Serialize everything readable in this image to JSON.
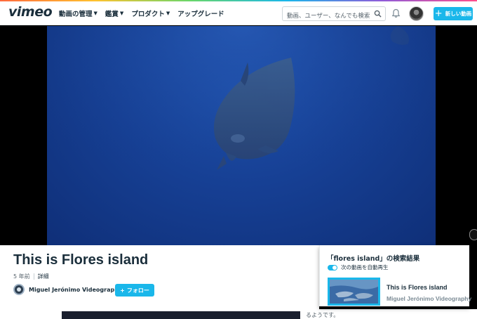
{
  "header": {
    "logo": "vimeo",
    "nav": [
      {
        "label": "動画の管理"
      },
      {
        "label": "鑑賞"
      },
      {
        "label": "プロダクト"
      },
      {
        "label": "アップグレード"
      }
    ],
    "search": {
      "placeholder": "動画、ユーザー、なんでも検索",
      "value": ""
    },
    "new_video_label": "新しい動画"
  },
  "video": {
    "title": "This is Flores island",
    "age": "5 年前",
    "detail_link": "詳細",
    "owner": "Miguel Jerónimo Videography",
    "follow_label": "フォロー"
  },
  "side": {
    "results_title": "「flores island」の検索結果",
    "autoplay_label": "次の動画を自動再生",
    "autoplay_on": true,
    "next": {
      "title": "This is Flores island",
      "owner": "Miguel Jerónimo Videography"
    }
  },
  "below": {
    "text": "るようです。"
  },
  "colors": {
    "accent": "#1ab7ea",
    "text_dark": "#1a2e3b",
    "video_blue": "#163f93"
  }
}
